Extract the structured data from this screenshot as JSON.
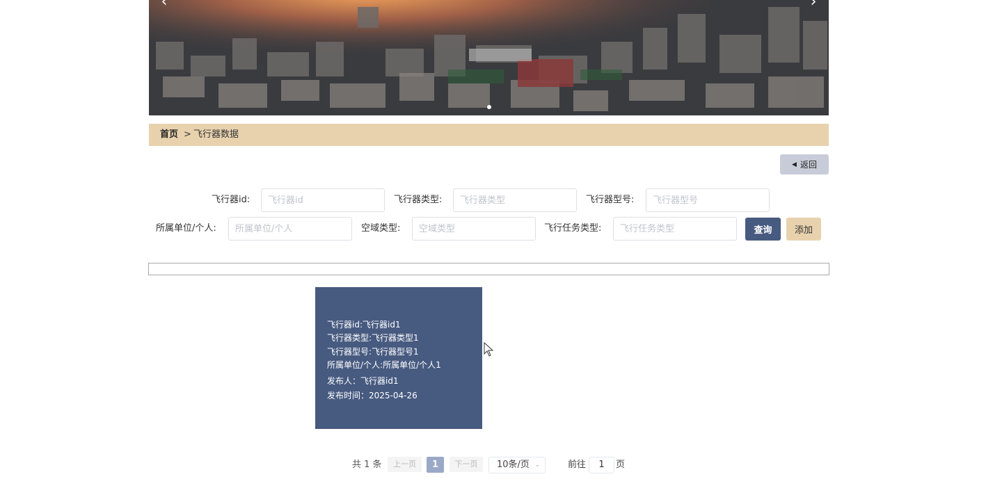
{
  "breadcrumb": {
    "home": "首页",
    "separator": ">",
    "current": "飞行器数据"
  },
  "back_button": {
    "label": "返回"
  },
  "search": {
    "fields": [
      {
        "label": "飞行器id:",
        "placeholder": "飞行器id"
      },
      {
        "label": "飞行器类型:",
        "placeholder": "飞行器类型"
      },
      {
        "label": "飞行器型号:",
        "placeholder": "飞行器型号"
      },
      {
        "label": "所属单位/个人:",
        "placeholder": "所属单位/个人"
      },
      {
        "label": "空域类型:",
        "placeholder": "空域类型"
      },
      {
        "label": "飞行任务类型:",
        "placeholder": "飞行任务类型"
      }
    ],
    "query_label": "查询",
    "add_label": "添加"
  },
  "card": {
    "lines": [
      "飞行器id:飞行器id1",
      "飞行器类型:飞行器类型1",
      "飞行器型号:飞行器型号1",
      "所属单位/个人:所属单位/个人1",
      "发布人：飞行器id1",
      "发布时间：2025-04-26"
    ]
  },
  "pagination": {
    "total": "共 1 条",
    "prev": "上一页",
    "current": "1",
    "next": "下一页",
    "page_size": "10条/页",
    "goto_label": "前往",
    "goto_value": "1",
    "page_suffix": "页"
  },
  "colors": {
    "accent": "#475a80",
    "beige": "#e8d2ae",
    "back_button": "#c7ccd8"
  }
}
